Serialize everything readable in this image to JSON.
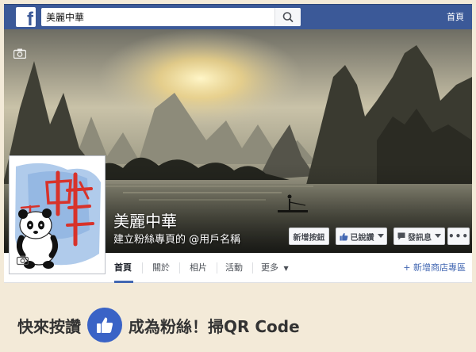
{
  "topbar": {
    "logo": "f",
    "search_value": "美麗中華",
    "home_label": "首頁"
  },
  "page": {
    "name": "美麗中華",
    "subtitle": "建立粉絲專頁的 @用戶名稱",
    "profile_text": "美麗中華"
  },
  "actions": {
    "create_label": "新增按鈕",
    "liked_label": "已說讚",
    "message_label": "發訊息",
    "more_label": "•••"
  },
  "nav": {
    "items": [
      "首頁",
      "關於",
      "相片",
      "活動",
      "更多"
    ],
    "add_shop_label": "+ 新增商店專區"
  },
  "banner": {
    "before": "快來按讚",
    "after": "成為粉絲！掃QR Code"
  },
  "colors": {
    "fb_blue": "#3b5998",
    "link_blue": "#4267b2",
    "background": "#f3ead8"
  },
  "icons": [
    "facebook-logo-icon",
    "search-icon",
    "camera-icon",
    "thumbs-up-icon",
    "message-icon",
    "chevron-down-icon",
    "panda-icon"
  ]
}
